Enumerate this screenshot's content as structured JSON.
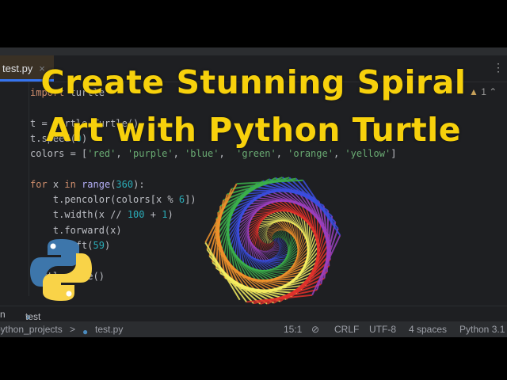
{
  "thumbnail": {
    "title_line1": "Create Stunning Spiral",
    "title_line2": "Art with Python Turtle",
    "title_color": "#f7d10c"
  },
  "editor": {
    "tab_label": "test.py",
    "tab_close": "×",
    "warnings_count": "1",
    "code": {
      "l1a": "import",
      "l1b": " turtle",
      "l3": "t = turtle.Turtle()",
      "l4a": "t.speed(",
      "l4b": "0",
      "l4c": ")",
      "l5a": "colors = [",
      "c1": "'red'",
      "c2": "'purple'",
      "c3": "'blue'",
      "c4": "'green'",
      "c5": "'orange'",
      "c6": "'yellow'",
      "l5z": "]",
      "l7a": "for",
      "l7b": " x ",
      "l7c": "in",
      "l7d": "range",
      "l7e": "(",
      "l7f": "360",
      "l7g": "):",
      "l8a": "    t.pencolor(colors[x % ",
      "l8b": "6",
      "l8c": "])",
      "l9a": "    t.width(x // ",
      "l9b": "100",
      "l9c": " + ",
      "l9d": "1",
      "l9e": ")",
      "l10": "    t.forward(x)",
      "l11a": "    t.left(",
      "l11b": "59",
      "l11c": ")",
      "l13": "turtle.done()"
    }
  },
  "run_panel": {
    "label_left": "n",
    "tab_label": "test",
    "tab_close": "×"
  },
  "status_bar": {
    "breadcrumb_project": "python_projects",
    "breadcrumb_sep": ">",
    "breadcrumb_file": "test.py",
    "position": "15:1",
    "line_ending": "CRLF",
    "encoding": "UTF-8",
    "indent": "4 spaces",
    "interpreter": "Python 3.1"
  },
  "spiral": {
    "steps": 360,
    "angle": 59,
    "colors": [
      "#e0302a",
      "#9a3fc0",
      "#3a4ee0",
      "#3bb04a",
      "#f0902a",
      "#f5ee60"
    ]
  }
}
